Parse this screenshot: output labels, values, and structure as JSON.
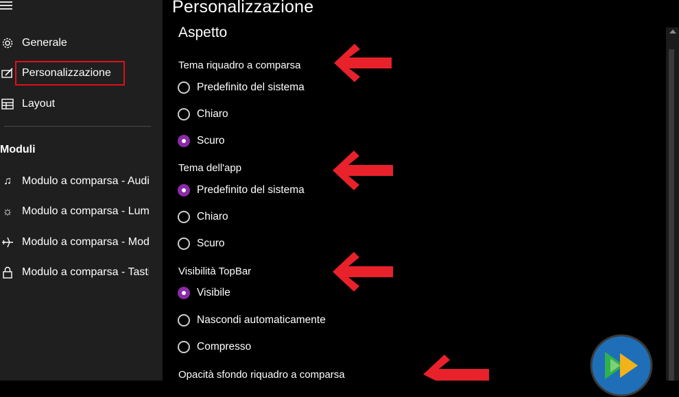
{
  "sidebar": {
    "items": [
      {
        "label": "Generale",
        "icon": "gear-icon"
      },
      {
        "label": "Personalizzazione",
        "icon": "personalize-icon",
        "selected": true
      },
      {
        "label": "Layout",
        "icon": "layout-icon"
      }
    ],
    "section_label": "Moduli",
    "modules": [
      {
        "label": "Modulo a comparsa - Audio",
        "icon": "music-note-icon"
      },
      {
        "label": "Modulo a comparsa - Luminosità",
        "icon": "brightness-icon"
      },
      {
        "label": "Modulo a comparsa - Modalità aereo",
        "icon": "airplane-icon"
      },
      {
        "label": "Modulo a comparsa - Tasti",
        "icon": "lock-icon"
      }
    ]
  },
  "page": {
    "title": "Personalizzazione",
    "section_title": "Aspetto"
  },
  "groups": {
    "flyout_theme": {
      "label": "Tema riquadro a comparsa",
      "options": [
        "Predefinito del sistema",
        "Chiaro",
        "Scuro"
      ],
      "selected": "Scuro"
    },
    "app_theme": {
      "label": "Tema dell'app",
      "options": [
        "Predefinito del sistema",
        "Chiaro",
        "Scuro"
      ],
      "selected": "Predefinito del sistema"
    },
    "topbar": {
      "label": "Visibilità TopBar",
      "options": [
        "Visibile",
        "Nascondi automaticamente",
        "Compresso"
      ],
      "selected": "Visibile"
    },
    "opacity": {
      "label": "Opacità sfondo riquadro a comparsa"
    }
  },
  "colors": {
    "accent": "#8a2aa8",
    "arrow": "#e8212b",
    "highlight_box": "#e0101a",
    "sidebar_bg": "#1f1f1f",
    "main_bg": "#000000"
  }
}
